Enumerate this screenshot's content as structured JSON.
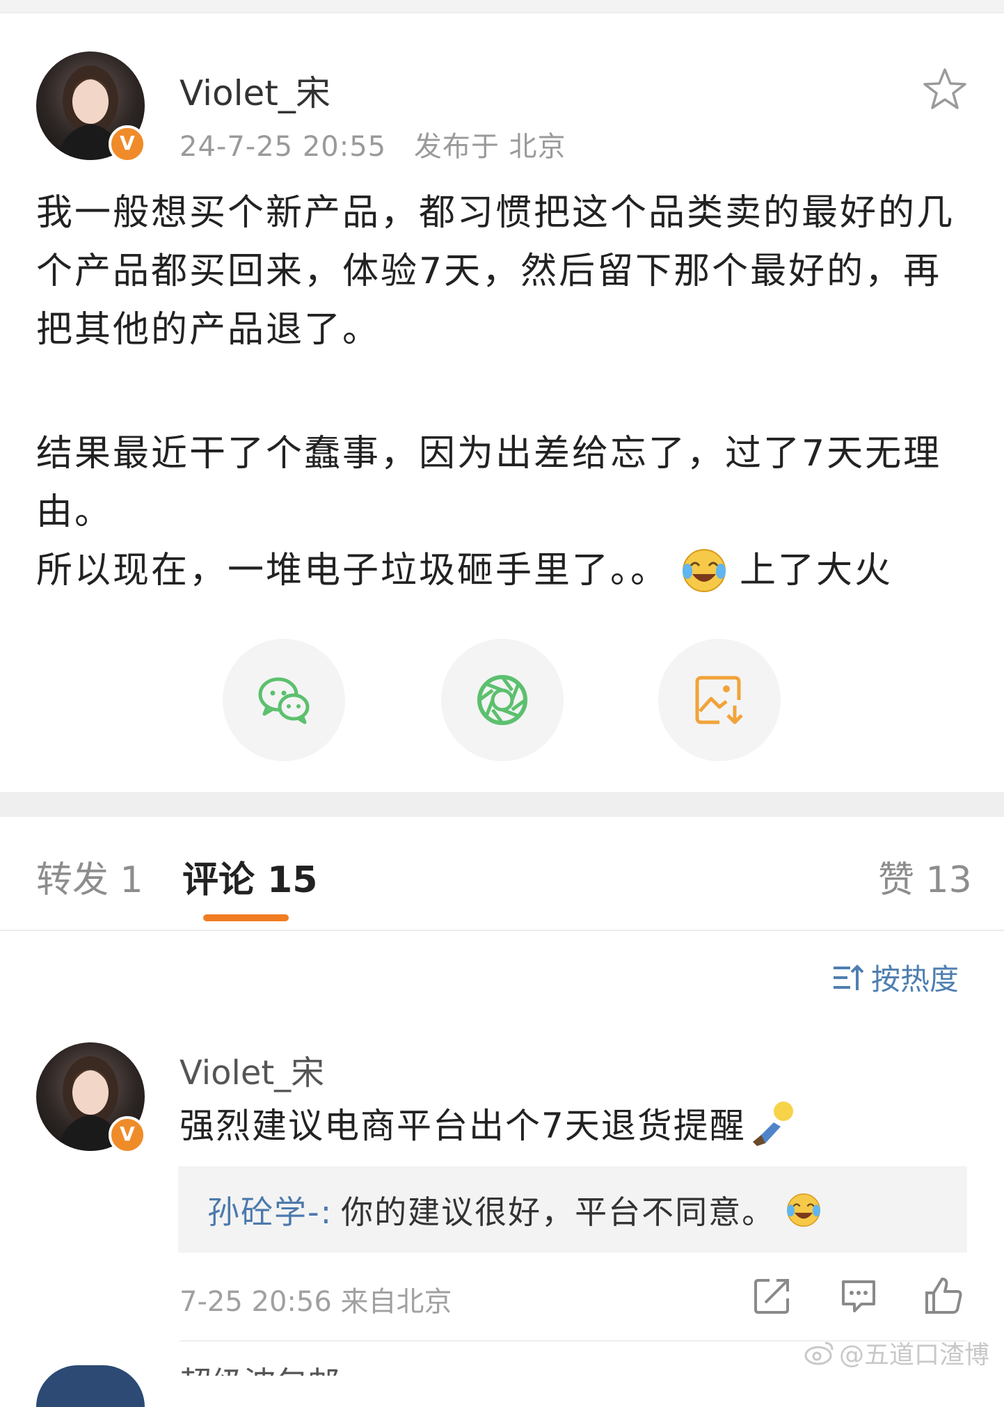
{
  "post": {
    "author": "Violet_宋",
    "time": "24-7-25 20:55",
    "location": "发布于 北京",
    "paragraph1": "我一般想买个新产品，都习惯把这个品类卖的最好的几个产品都买回来，体验7天，然后留下那个最好的，再把其他的产品退了。",
    "paragraph2": "结果最近干了个蠢事，因为出差给忘了，过了7天无理由。",
    "paragraph3_prefix": "所以现在，一堆电子垃圾砸手里了。。",
    "paragraph3_suffix": "上了大火",
    "verified_badge": "V"
  },
  "share": {
    "icons": [
      "wechat-icon",
      "moments-icon",
      "save-image-icon"
    ]
  },
  "tabs": {
    "repost_label": "转发 1",
    "comment_label": "评论 15",
    "like_label": "赞 13"
  },
  "sort": {
    "label": "按热度"
  },
  "comment": {
    "author": "Violet_宋",
    "text": "强烈建议电商平台出个7天退货提醒",
    "reply_author": "孙砼学-:",
    "reply_text": "你的建议很好，平台不同意。",
    "time": "7-25 20:56  来自北京",
    "verified_badge": "V"
  },
  "next_comment": {
    "author": "超级波包邮"
  },
  "watermark": {
    "text": "@五道口渣博"
  },
  "colors": {
    "accent": "#f07d22",
    "link": "#4c79ad",
    "wechat": "#5cc06e",
    "save": "#f1a33a"
  }
}
